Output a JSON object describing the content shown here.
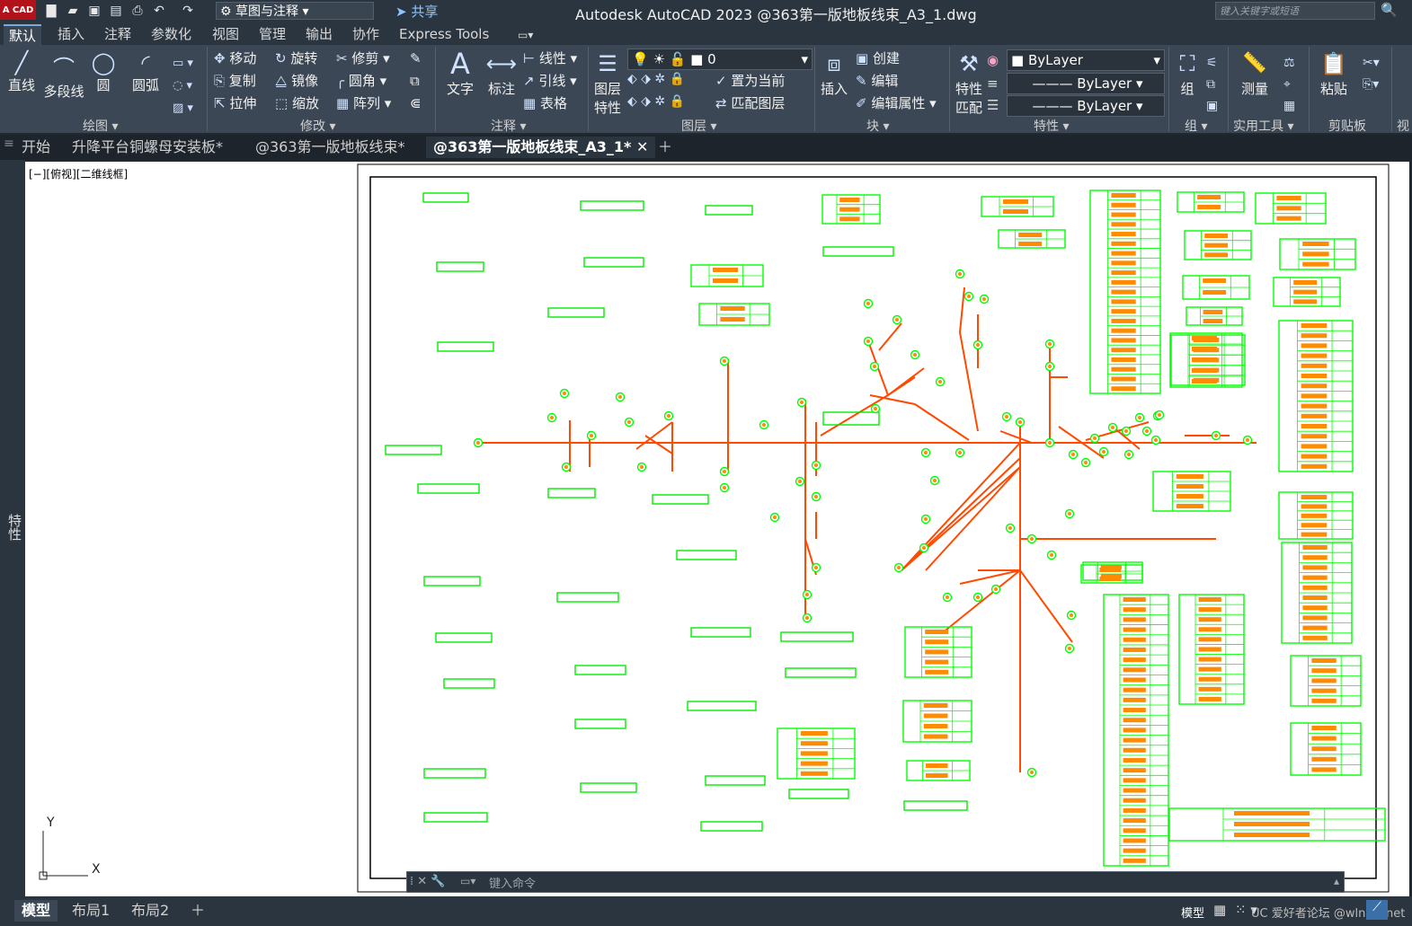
{
  "titlebar": {
    "logo_text": "A CAD",
    "workspace": "草图与注释",
    "share": "共享",
    "app_title": "Autodesk AutoCAD 2023    @363第一版地板线束_A3_1.dwg",
    "search_placeholder": "键入关键字或短语"
  },
  "ribbon_tabs": [
    "默认",
    "插入",
    "注释",
    "参数化",
    "视图",
    "管理",
    "输出",
    "协作",
    "Express Tools"
  ],
  "ribbon": {
    "draw": {
      "title": "绘图",
      "line": "直线",
      "polyline": "多段线",
      "circle": "圆",
      "arc": "圆弧"
    },
    "modify": {
      "title": "修改",
      "move": "移动",
      "rotate": "旋转",
      "trim": "修剪",
      "copy": "复制",
      "mirror": "镜像",
      "fillet": "圆角",
      "stretch": "拉伸",
      "scale": "缩放",
      "array": "阵列"
    },
    "annotation": {
      "title": "注释",
      "text": "文字",
      "dimension": "标注",
      "linear": "线性",
      "leader": "引线",
      "table": "表格"
    },
    "layers": {
      "title": "图层",
      "layer_props": "图层",
      "layer_props2": "特性",
      "current_layer": "0",
      "set_current": "置为当前",
      "match_layer": "匹配图层"
    },
    "block": {
      "title": "块",
      "insert": "插入",
      "create": "创建",
      "edit": "编辑",
      "edit_attr": "编辑属性"
    },
    "properties": {
      "title": "特性",
      "match": "特性",
      "match2": "匹配",
      "color": "ByLayer",
      "linetype": "ByLayer",
      "lineweight": "ByLayer"
    },
    "groups": {
      "title": "组",
      "group": "组"
    },
    "utilities": {
      "title": "实用工具",
      "measure": "测量"
    },
    "clipboard": {
      "title": "剪贴板",
      "paste": "粘贴"
    },
    "view": {
      "title": "视"
    }
  },
  "doc_tabs": [
    "开始",
    "升降平台铜螺母安装板*",
    "@363第一版地板线束*",
    "@363第一版地板线束_A3_1*"
  ],
  "viewport": {
    "label": "[−][俯视][二维线框]",
    "axis_y": "Y",
    "axis_x": "X"
  },
  "left_palette": {
    "label": "特性"
  },
  "command": {
    "placeholder": "键入命令"
  },
  "layout_tabs": [
    "模型",
    "布局1",
    "布局2"
  ],
  "status": {
    "model": "模型",
    "watermark": "UC 爱好者论坛 @wlnmy.net"
  },
  "colors": {
    "wire": "#ff4a00",
    "table": "#00ff00",
    "connector": "#ff8c00",
    "background": "#212830"
  }
}
